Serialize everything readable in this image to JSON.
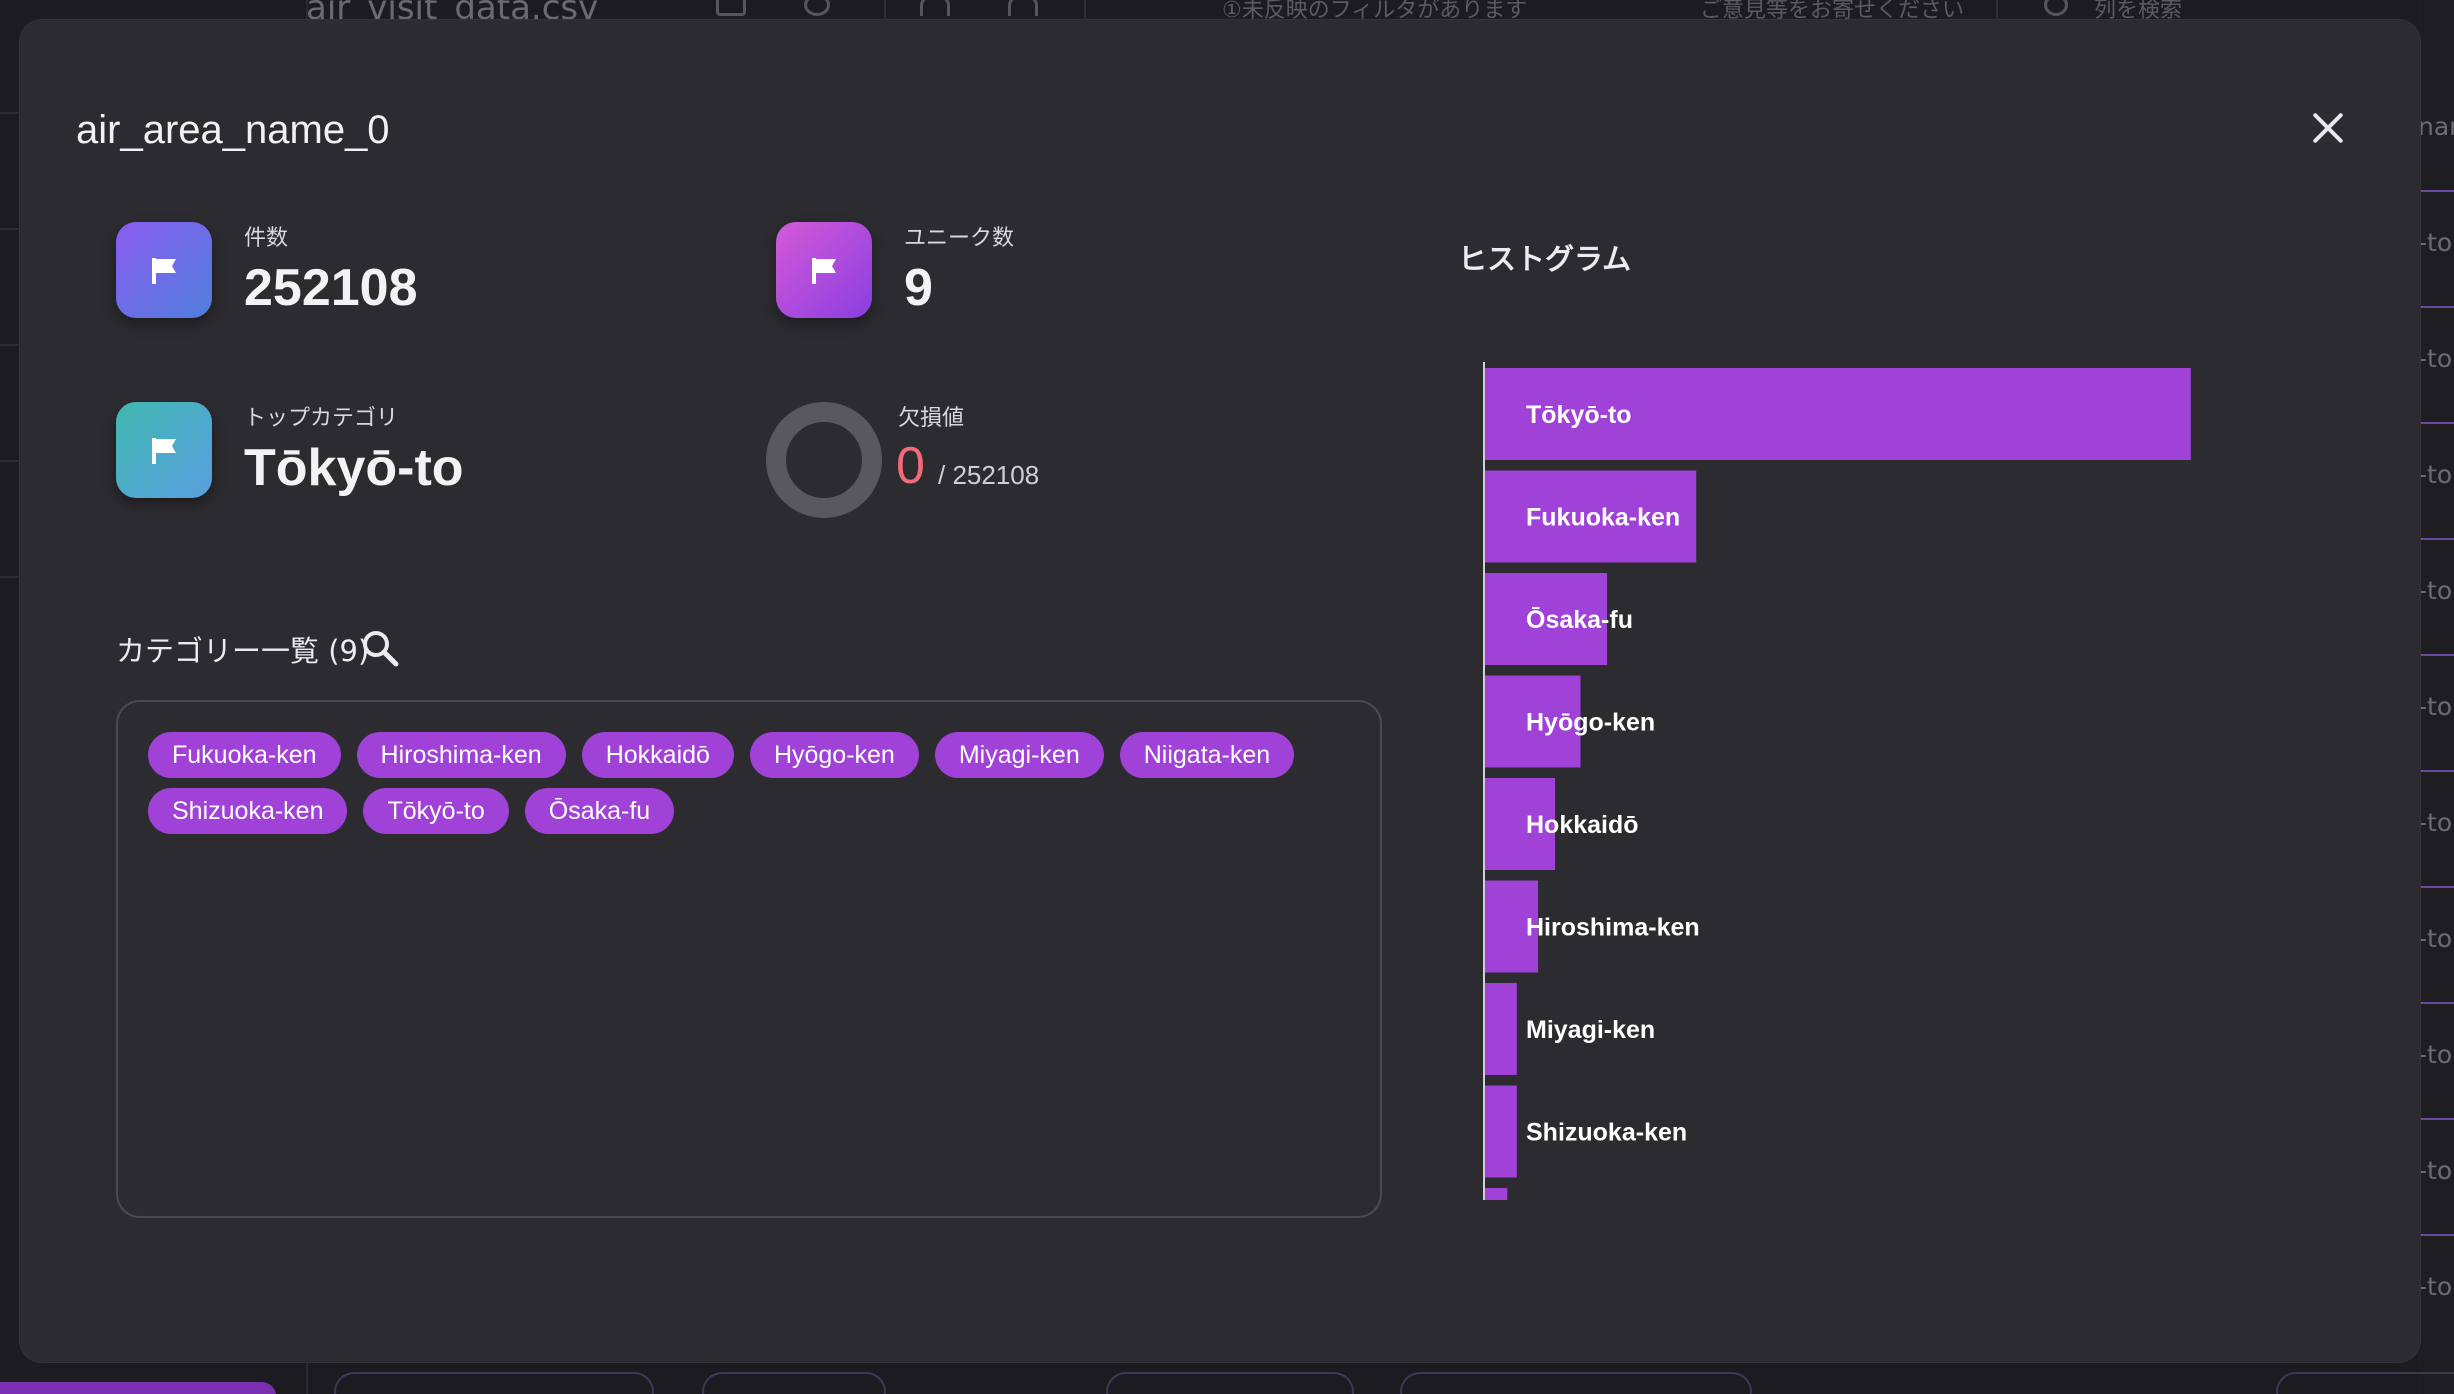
{
  "background": {
    "file_name": "air_visit_data.csv",
    "filter_notice": "①未反映のフィルタがあります",
    "feedback": "ご意見等をお寄せください",
    "search_placeholder": "列を検索",
    "right_column_header": "nar",
    "right_column_cell": "-to"
  },
  "modal": {
    "title": "air_area_name_0",
    "stats": {
      "count_label": "件数",
      "count_value": "252108",
      "unique_label": "ユニーク数",
      "unique_value": "9",
      "top_label": "トップカテゴリ",
      "top_value": "Tōkyō-to",
      "missing_label": "欠損値",
      "missing_value": "0",
      "missing_total": "/ 252108"
    },
    "categories": {
      "title": "カテゴリー一覧 (9)",
      "items": [
        "Fukuoka-ken",
        "Hiroshima-ken",
        "Hokkaidō",
        "Hyōgo-ken",
        "Miyagi-ken",
        "Niigata-ken",
        "Shizuoka-ken",
        "Tōkyō-to",
        "Ōsaka-fu"
      ]
    },
    "histogram_title": "ヒストグラム"
  },
  "colors": {
    "bar": "#a042d8",
    "chip": "#a042d8",
    "missing": "#f06a7a"
  },
  "chart_data": {
    "type": "bar",
    "orientation": "horizontal",
    "categories": [
      "Tōkyō-to",
      "Fukuoka-ken",
      "Ōsaka-fu",
      "Hyōgo-ken",
      "Hokkaidō",
      "Hiroshima-ken",
      "Miyagi-ken",
      "Shizuoka-ken",
      "Niigata-ken"
    ],
    "values": [
      133000,
      39800,
      23000,
      18000,
      13200,
      10000,
      6000,
      6000,
      4200
    ],
    "xlabel": "air_area_name_0",
    "xlim": [
      0,
      150000
    ],
    "xticks": [
      0,
      30000,
      60000,
      90000,
      120000,
      150000
    ],
    "grid": false
  }
}
